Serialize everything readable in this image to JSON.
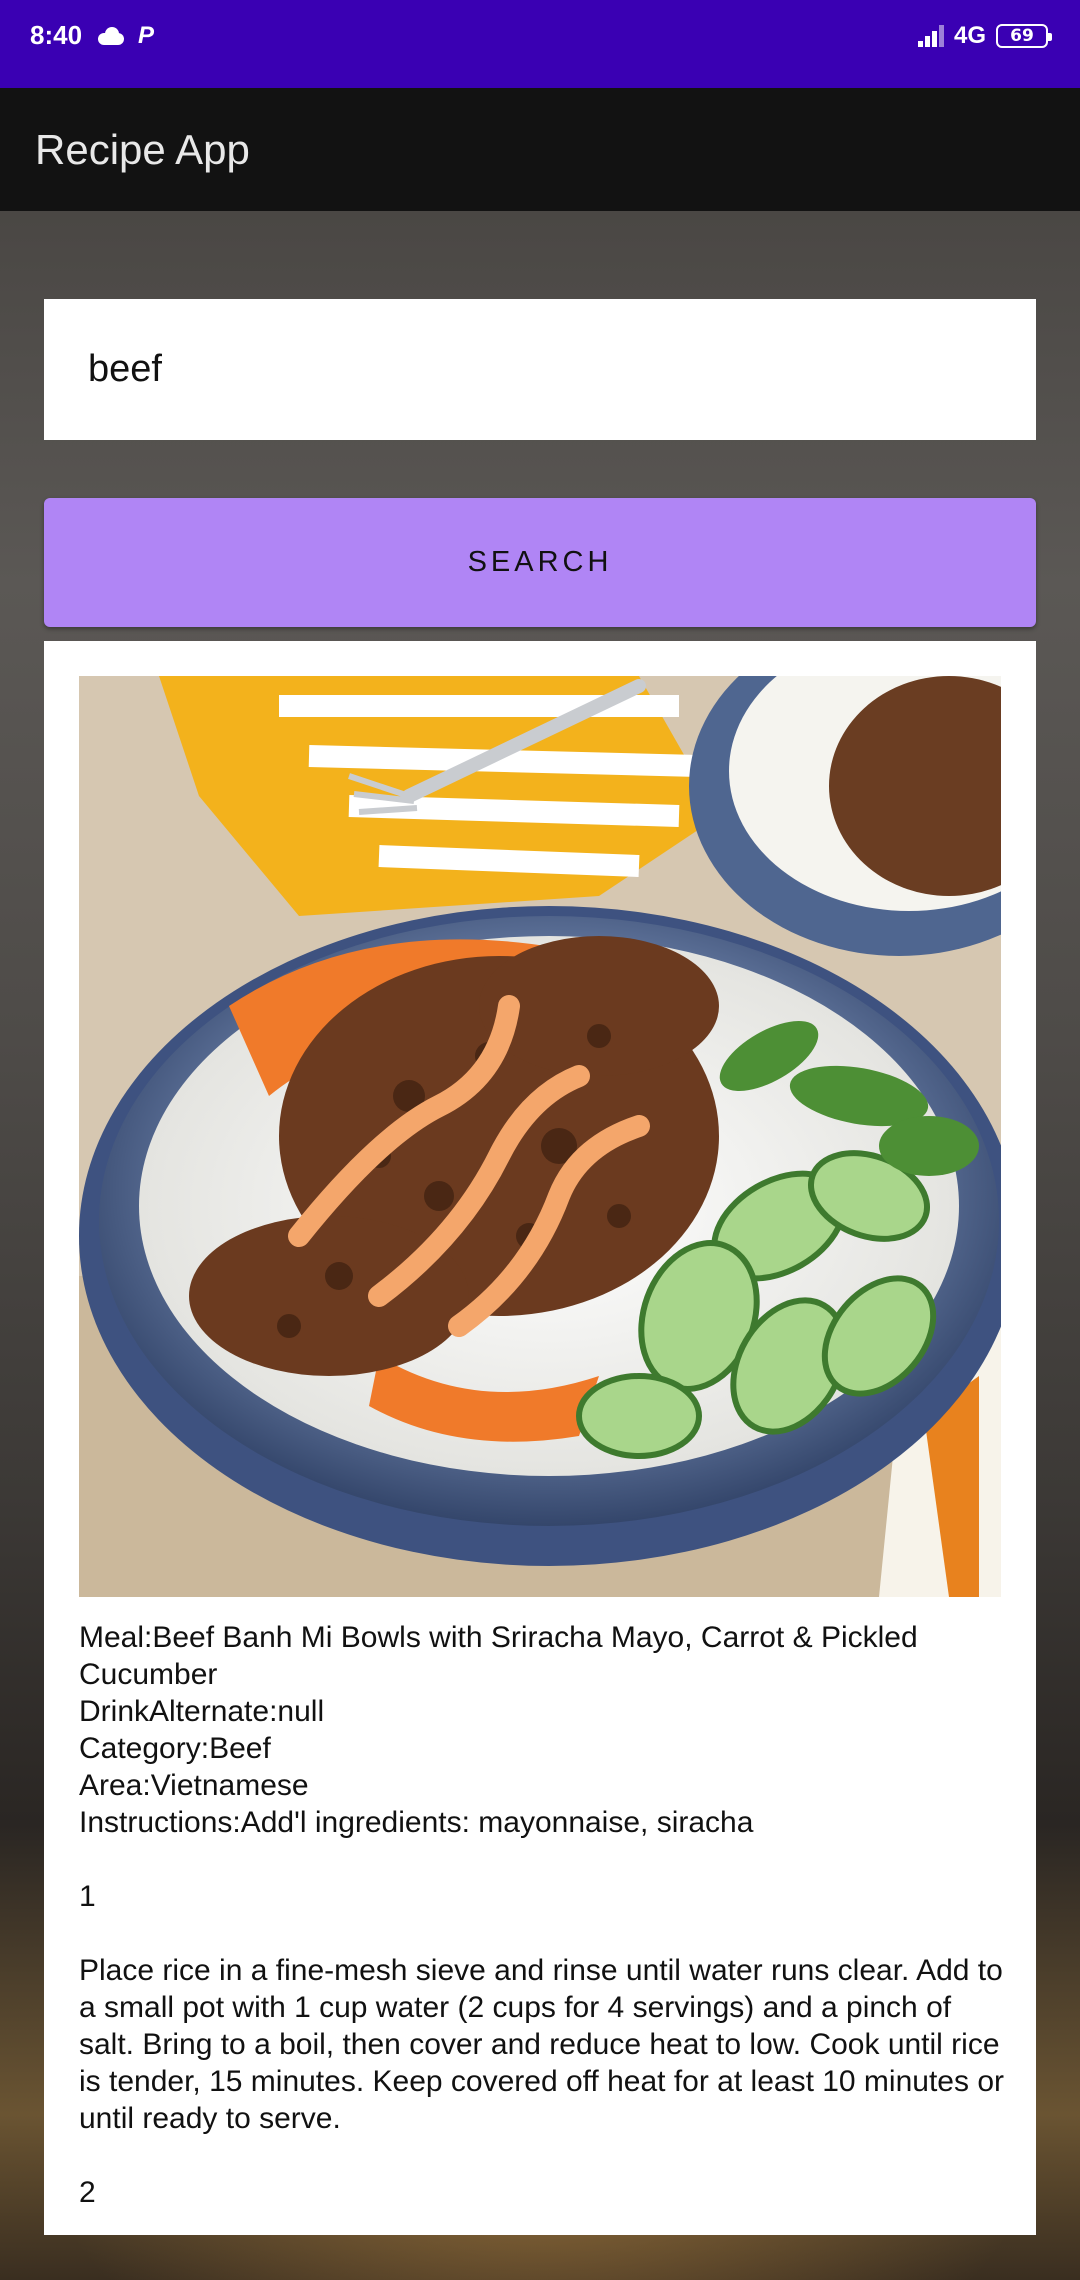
{
  "status_bar": {
    "time": "8:40",
    "network": "4G",
    "battery": "69",
    "icons": [
      "cloud-icon",
      "parking-icon",
      "signal-icon",
      "battery-icon"
    ]
  },
  "app_bar": {
    "title": "Recipe App"
  },
  "search": {
    "value": "beef",
    "button_label": "SEARCH"
  },
  "result": {
    "image": "beef-banh-mi-bowl-photo",
    "meal": "Meal:Beef Banh Mi Bowls with Sriracha Mayo, Carrot & Pickled Cucumber",
    "drink_alternate": "DrinkAlternate:null",
    "category": "Category:Beef",
    "area": "Area:Vietnamese",
    "instructions_intro": "Instructions:Add'l ingredients: mayonnaise, siracha",
    "step1_number": "1",
    "step1_text": "Place rice in a fine-mesh sieve and rinse until water runs clear. Add to a small pot with 1 cup water (2 cups for 4 servings) and a pinch of salt. Bring to a boil, then cover and reduce heat to low. Cook until rice is tender, 15 minutes. Keep covered off heat for at least 10 minutes or until ready to serve.",
    "step2_number": "2"
  },
  "colors": {
    "status_bar": "#3a00b3",
    "app_bar": "#121212",
    "button": "#b085f5"
  }
}
